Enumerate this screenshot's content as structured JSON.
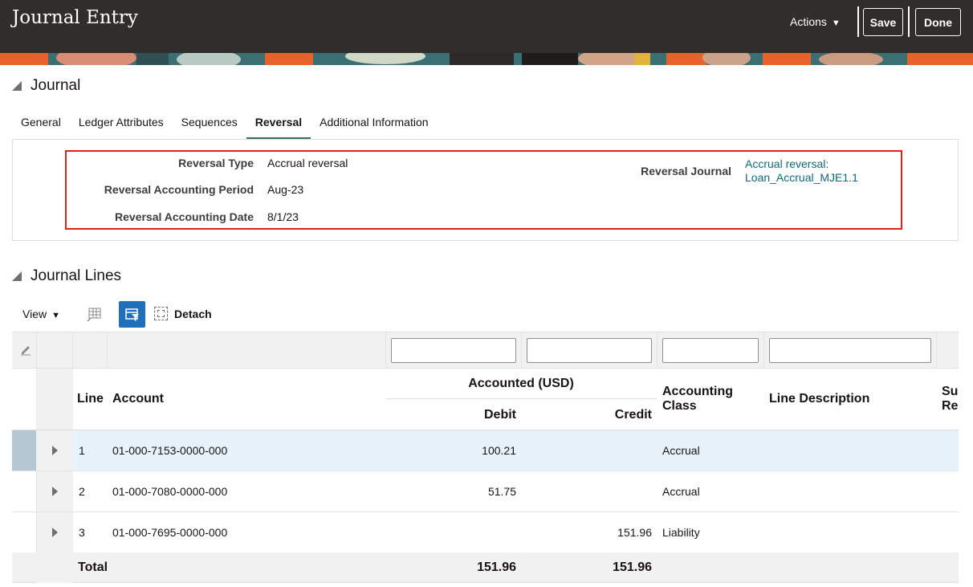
{
  "header": {
    "title": "Journal Entry",
    "actions_label": "Actions",
    "save_label": "Save",
    "done_label": "Done"
  },
  "journal_section": {
    "title": "Journal",
    "tabs": [
      {
        "label": "General"
      },
      {
        "label": "Ledger Attributes"
      },
      {
        "label": "Sequences"
      },
      {
        "label": "Reversal",
        "active": true
      },
      {
        "label": "Additional Information"
      }
    ],
    "reversal": {
      "type_label": "Reversal Type",
      "type_value": "Accrual reversal",
      "period_label": "Reversal Accounting Period",
      "period_value": "Aug-23",
      "date_label": "Reversal Accounting Date",
      "date_value": "8/1/23",
      "journal_label": "Reversal Journal",
      "journal_link_line1": "Accrual reversal:",
      "journal_link_line2": "Loan_Accrual_MJE1.1"
    }
  },
  "lines_section": {
    "title": "Journal Lines",
    "toolbar": {
      "view_label": "View",
      "detach_label": "Detach"
    },
    "columns": {
      "line": "Line",
      "account": "Account",
      "accounted_group": "Accounted (USD)",
      "debit": "Debit",
      "credit": "Credit",
      "accounting_class_1": "Accounting",
      "accounting_class_2": "Class",
      "line_description": "Line Description",
      "partial_1": "Su",
      "partial_2": "Re"
    },
    "rows": [
      {
        "line": "1",
        "account": "01-000-7153-0000-000",
        "debit": "100.21",
        "credit": "",
        "class": "Accrual"
      },
      {
        "line": "2",
        "account": "01-000-7080-0000-000",
        "debit": "51.75",
        "credit": "",
        "class": "Accrual"
      },
      {
        "line": "3",
        "account": "01-000-7695-0000-000",
        "debit": "",
        "credit": "151.96",
        "class": "Liability"
      }
    ],
    "total": {
      "label": "Total",
      "debit": "151.96",
      "credit": "151.96"
    }
  },
  "colors": {
    "header_bg": "#312d2a",
    "highlight_border": "#e0201d",
    "link": "#0f6a7a",
    "selected_row": "#e8f2fb",
    "active_tab_underline": "#3e6c5a"
  }
}
